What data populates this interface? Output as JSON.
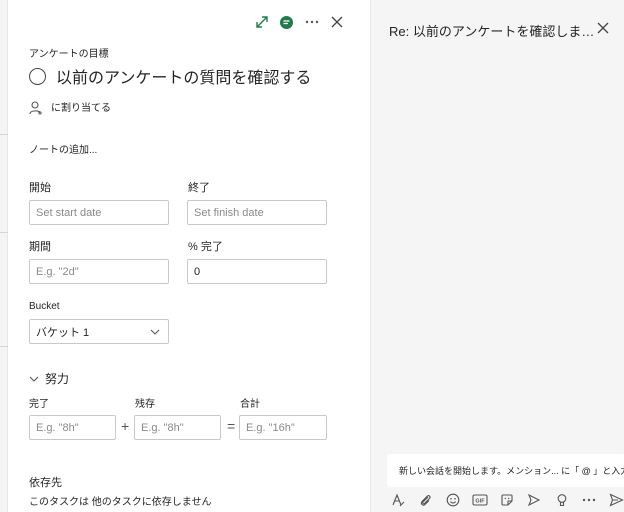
{
  "colors": {
    "accent": "#237b4b",
    "panel_bg": "#f5f5f5",
    "border": "#c8c8c8"
  },
  "task": {
    "goal_label": "アンケートの目標",
    "title": "以前のアンケートの質問を確認する",
    "assign_label": "に割り当てる",
    "notes_placeholder": "ノートの追加..."
  },
  "dates": {
    "start_label": "開始",
    "start_placeholder": "Set start date",
    "finish_label": "終了",
    "finish_placeholder": "Set finish date",
    "duration_label": "期間",
    "duration_placeholder": "E.g. \"2d\"",
    "percent_label": "% 完了",
    "percent_value": "0"
  },
  "bucket": {
    "label": "Bucket",
    "value": "バケット 1"
  },
  "effort": {
    "section_label": "努力",
    "completed_label": "完了",
    "completed_placeholder": "E.g. \"8h\"",
    "remaining_label": "残存",
    "remaining_placeholder": "E.g. \"8h\"",
    "total_label": "合計",
    "total_placeholder": "E.g. \"16h\"",
    "plus": "+",
    "equals": "="
  },
  "dependencies": {
    "label": "依存先",
    "text": "このタスクは 他のタスクに依存しません"
  },
  "chat": {
    "title": "Re: 以前のアンケートを確認します。...",
    "compose_placeholder": "新しい会話を開始します。メンション... に「 @ 」と入力します。"
  },
  "icons": {
    "top": [
      "expand-icon",
      "chat-icon",
      "more-icon",
      "close-icon"
    ],
    "toolbar": [
      "format-icon",
      "attach-icon",
      "emoji-icon",
      "gif-icon",
      "sticker-icon",
      "meet-icon",
      "praise-icon",
      "more-icon",
      "send-icon"
    ]
  }
}
